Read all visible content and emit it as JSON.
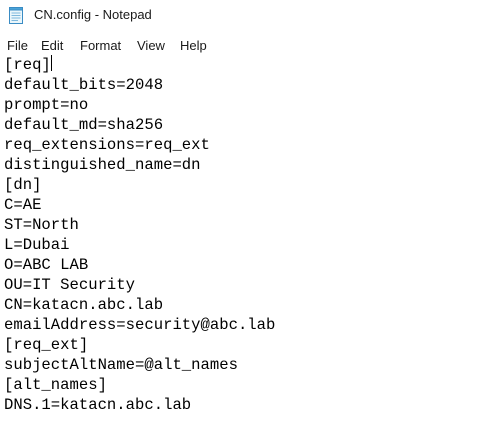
{
  "window": {
    "title": "CN.config - Notepad",
    "icon": "notepad-icon"
  },
  "menu": {
    "file": "File",
    "edit": "Edit",
    "format": "Format",
    "view": "View",
    "help": "Help"
  },
  "editor": {
    "lines": [
      "[req]",
      "default_bits=2048",
      "prompt=no",
      "default_md=sha256",
      "req_extensions=req_ext",
      "distinguished_name=dn",
      "[dn]",
      "C=AE",
      "ST=North",
      "L=Dubai",
      "O=ABC LAB",
      "OU=IT Security",
      "CN=katacn.abc.lab",
      "emailAddress=security@abc.lab",
      "[req_ext]",
      "subjectAltName=@alt_names",
      "[alt_names]",
      "DNS.1=katacn.abc.lab"
    ]
  }
}
